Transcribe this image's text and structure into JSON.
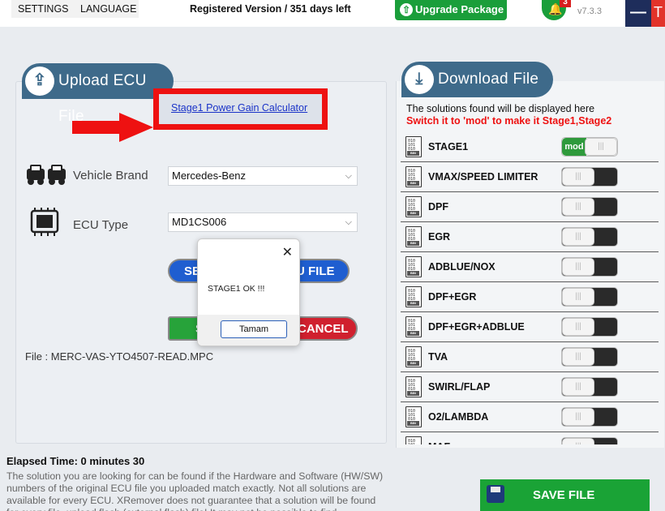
{
  "topbar": {
    "settings": "SETTINGS",
    "language": "LANGUAGE",
    "registration": "Registered Version / 351 days left",
    "upgrade": "Upgrade Package",
    "notifications_count": "3",
    "version": "v7.3.3",
    "minimize": "—",
    "close": "T"
  },
  "upload": {
    "tab_title": "Upload ECU File",
    "calc_link": "Stage1 Power Gain Calculator",
    "vehicle_brand_label": "Vehicle Brand",
    "vehicle_brand_value": "Mercedes-Benz",
    "ecu_type_label": "ECU Type",
    "ecu_type_value": "MD1CS006",
    "select_button_left": "SE",
    "select_button_right": "U FILE",
    "start_button": "S",
    "cancel_button": "CANCEL",
    "file_line": "File : MERC-VAS-YTO4507-READ.MPC"
  },
  "dialog": {
    "message": "STAGE1 OK !!!",
    "ok": "Tamam",
    "close_glyph": "✕"
  },
  "status": {
    "elapsed": "Elapsed Time:  0 minutes 30",
    "notice": "The solution you are looking for can be found if the Hardware and Software (HW/SW) numbers of the original ECU file you uploaded match exactly. Not all solutions are available for every ECU. XRemover does not guarantee that a solution will be found for every file, upload flash (external flash) file! It may not be possible to find"
  },
  "download": {
    "tab_title": "Download File",
    "info_line": "The solutions found will be displayed here",
    "hint_line": "Switch it to 'mod' to make it Stage1,Stage2",
    "solutions": [
      {
        "name": "STAGE1",
        "state": "mod"
      },
      {
        "name": "VMAX/SPEED LIMITER",
        "state": "off"
      },
      {
        "name": "DPF",
        "state": "off"
      },
      {
        "name": "EGR",
        "state": "off"
      },
      {
        "name": "ADBLUE/NOX",
        "state": "off"
      },
      {
        "name": "DPF+EGR",
        "state": "off"
      },
      {
        "name": "DPF+EGR+ADBLUE",
        "state": "off"
      },
      {
        "name": "TVA",
        "state": "off"
      },
      {
        "name": "SWIRL/FLAP",
        "state": "off"
      },
      {
        "name": "O2/LAMBDA",
        "state": "off"
      },
      {
        "name": "MAF",
        "state": "off"
      }
    ],
    "file_icon_label": "BIN",
    "save_button": "SAVE FILE"
  },
  "colors": {
    "accent_green": "#1a9e3a",
    "tab_blue": "#3e6a8a",
    "highlight_red": "#ee1111"
  }
}
